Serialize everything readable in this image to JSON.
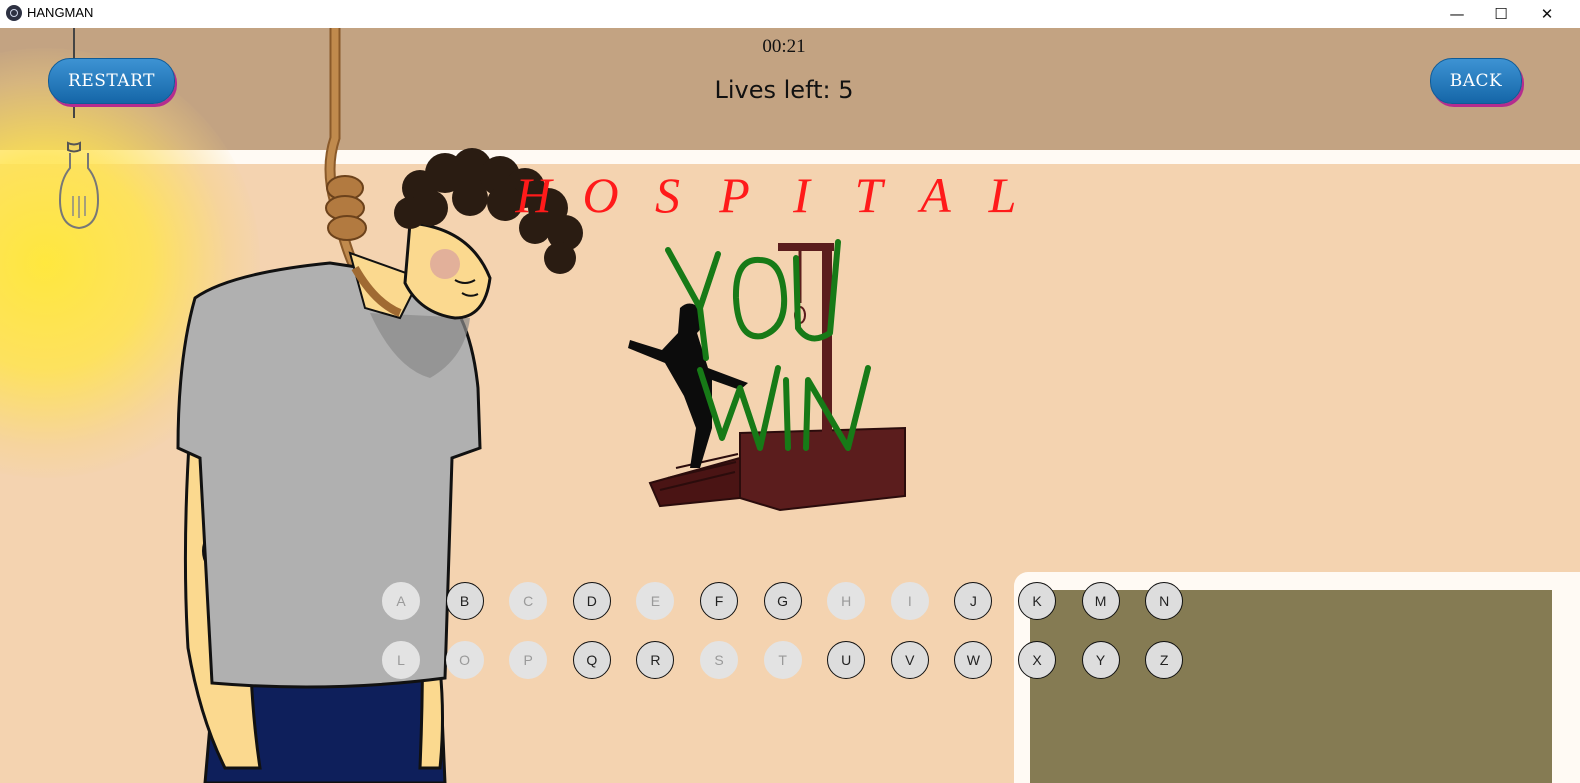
{
  "window": {
    "title": "HANGMAN",
    "minimize_glyph": "—",
    "maximize_glyph": "☐",
    "close_glyph": "✕"
  },
  "header": {
    "restart_label": "RESTART",
    "back_label": "BACK",
    "timer": "00:21",
    "lives": "Lives left: 5"
  },
  "word_letters": [
    "H",
    "O",
    "S",
    "P",
    "I",
    "T",
    "A",
    "L"
  ],
  "result_image": {
    "line1": "YOU",
    "line2": "WIN"
  },
  "keyboard": {
    "row1": [
      {
        "letter": "A",
        "used": true
      },
      {
        "letter": "B",
        "used": false
      },
      {
        "letter": "C",
        "used": true
      },
      {
        "letter": "D",
        "used": false
      },
      {
        "letter": "E",
        "used": true
      },
      {
        "letter": "F",
        "used": false
      },
      {
        "letter": "G",
        "used": false
      },
      {
        "letter": "H",
        "used": true
      },
      {
        "letter": "I",
        "used": true
      },
      {
        "letter": "J",
        "used": false
      },
      {
        "letter": "K",
        "used": false
      },
      {
        "letter": "M",
        "used": false
      },
      {
        "letter": "N",
        "used": false
      }
    ],
    "row2": [
      {
        "letter": "L",
        "used": true
      },
      {
        "letter": "O",
        "used": true
      },
      {
        "letter": "P",
        "used": true
      },
      {
        "letter": "Q",
        "used": false
      },
      {
        "letter": "R",
        "used": false
      },
      {
        "letter": "S",
        "used": true
      },
      {
        "letter": "T",
        "used": true
      },
      {
        "letter": "U",
        "used": false
      },
      {
        "letter": "V",
        "used": false
      },
      {
        "letter": "W",
        "used": false
      },
      {
        "letter": "X",
        "used": false
      },
      {
        "letter": "Y",
        "used": false
      },
      {
        "letter": "Z",
        "used": false
      }
    ]
  },
  "colors": {
    "word": "#ff1a1a",
    "button": "#1e78bd",
    "win_text": "#177a17",
    "wall_top": "#c3a382",
    "wall": "#f4d3b0"
  },
  "icons": [
    "app-icon",
    "minimize-icon",
    "maximize-icon",
    "close-icon",
    "light-bulb-icon",
    "noose-icon",
    "gallows-icon"
  ]
}
